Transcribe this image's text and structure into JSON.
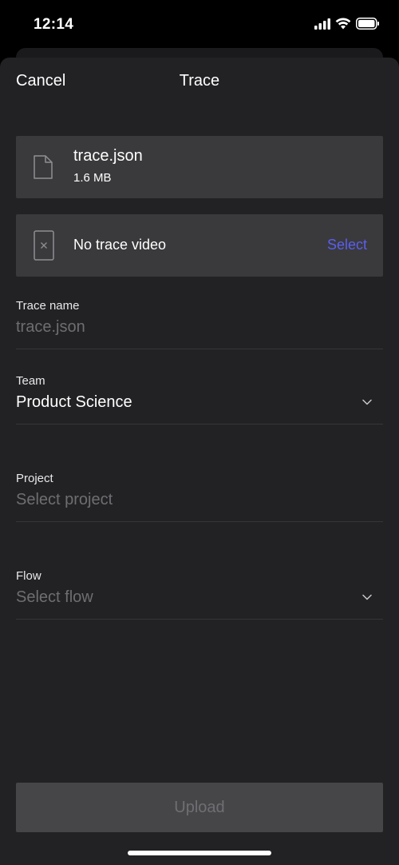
{
  "status_bar": {
    "time": "12:14"
  },
  "nav": {
    "cancel_label": "Cancel",
    "title": "Trace"
  },
  "trace_file": {
    "name": "trace.json",
    "size": "1.6 MB",
    "icon": "file-icon"
  },
  "trace_video": {
    "label": "No trace video",
    "select_label": "Select",
    "icon": "video-missing-icon"
  },
  "fields": {
    "trace_name": {
      "label": "Trace name",
      "placeholder": "trace.json"
    },
    "team": {
      "label": "Team",
      "value": "Product Science"
    },
    "project": {
      "label": "Project",
      "placeholder": "Select project"
    },
    "flow": {
      "label": "Flow",
      "placeholder": "Select flow"
    }
  },
  "upload": {
    "label": "Upload",
    "enabled": false
  },
  "colors": {
    "background": "#000000",
    "sheet": "#222224",
    "card": "#3a3a3c",
    "accent": "#5b5ef0",
    "button_disabled": "#464649",
    "placeholder_text": "#6e6e72"
  }
}
